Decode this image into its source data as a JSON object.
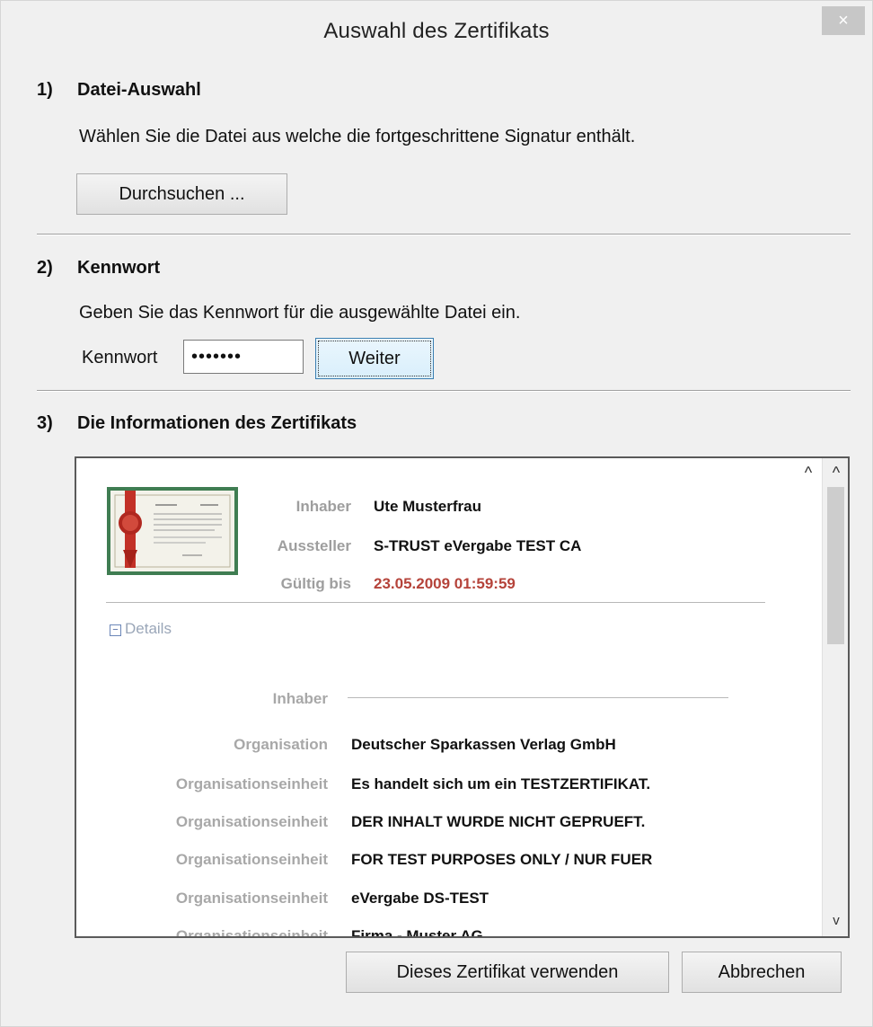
{
  "window": {
    "title": "Auswahl des Zertifikats",
    "close_glyph": "×"
  },
  "section1": {
    "number": "1)",
    "title": "Datei-Auswahl",
    "description": "Wählen Sie die Datei aus welche die fortgeschrittene Signatur enthält.",
    "browse_label": "Durchsuchen ..."
  },
  "section2": {
    "number": "2)",
    "title": "Kennwort",
    "description": "Geben Sie das Kennwort für die ausgewählte Datei ein.",
    "password_label": "Kennwort",
    "password_value": "•••••••",
    "next_label": "Weiter"
  },
  "section3": {
    "number": "3)",
    "title": "Die Informationen des Zertifikats",
    "summary": [
      {
        "label": "Inhaber",
        "value": "Ute Musterfrau"
      },
      {
        "label": "Aussteller",
        "value": "S-TRUST eVergabe TEST CA"
      },
      {
        "label": "Gültig bis",
        "value": "23.05.2009 01:59:59"
      }
    ],
    "details_toggle": "Details",
    "details_box_glyph": "−",
    "group_heading": "Inhaber",
    "details": [
      {
        "label": "Organisation",
        "value": "Deutscher Sparkassen Verlag GmbH"
      },
      {
        "label": "Organisationseinheit",
        "value": "Es handelt sich um ein TESTZERTIFIKAT."
      },
      {
        "label": "Organisationseinheit",
        "value": "DER INHALT WURDE NICHT GEPRUEFT."
      },
      {
        "label": "Organisationseinheit",
        "value": "FOR TEST PURPOSES ONLY / NUR FUER"
      },
      {
        "label": "Organisationseinheit",
        "value": "eVergabe DS-TEST"
      },
      {
        "label": "Organisationseinheit",
        "value": "Firma - Muster AG"
      }
    ],
    "scroll_up_glyph": "^",
    "scroll_down_glyph": "v"
  },
  "footer": {
    "use_label": "Dieses Zertifikat verwenden",
    "cancel_label": "Abbrechen"
  },
  "colors": {
    "accent_date": "#b5433a",
    "label_gray": "#9e9e9e"
  }
}
